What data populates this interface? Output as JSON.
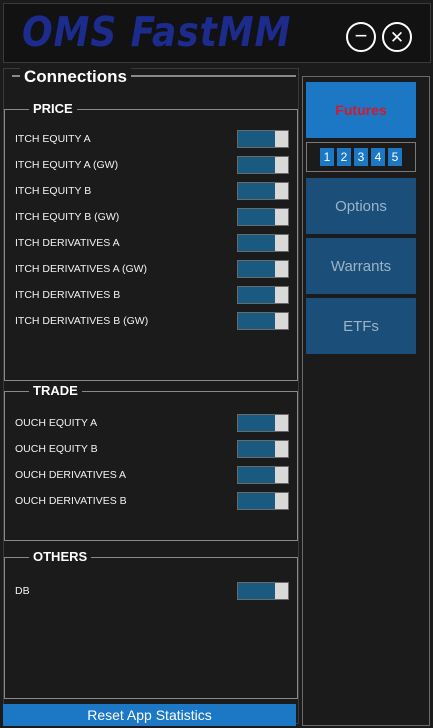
{
  "app": {
    "title": "OMS FastMM",
    "minimize_icon": "−",
    "close_icon": "✕"
  },
  "connections": {
    "title": "Connections",
    "groups": [
      {
        "title": "PRICE",
        "items": [
          {
            "label": "ITCH EQUITY A",
            "on": true
          },
          {
            "label": "ITCH EQUITY A (GW)",
            "on": true
          },
          {
            "label": "ITCH EQUITY B",
            "on": true
          },
          {
            "label": "ITCH EQUITY B (GW)",
            "on": true
          },
          {
            "label": "ITCH DERIVATIVES A",
            "on": true
          },
          {
            "label": "ITCH DERIVATIVES A (GW)",
            "on": true
          },
          {
            "label": "ITCH DERIVATIVES B",
            "on": true
          },
          {
            "label": "ITCH DERIVATIVES B (GW)",
            "on": true
          }
        ]
      },
      {
        "title": "TRADE",
        "items": [
          {
            "label": "OUCH EQUITY A",
            "on": true
          },
          {
            "label": "OUCH EQUITY B",
            "on": true
          },
          {
            "label": "OUCH DERIVATIVES A",
            "on": true
          },
          {
            "label": "OUCH DERIVATIVES B",
            "on": true
          }
        ]
      },
      {
        "title": "OTHERS",
        "items": [
          {
            "label": "DB",
            "on": true
          }
        ]
      }
    ],
    "reset_label": "Reset App Statistics"
  },
  "sidebar": {
    "active": "Futures",
    "numbers": [
      "1",
      "2",
      "3",
      "4",
      "5"
    ],
    "others": [
      "Options",
      "Warrants",
      "ETFs"
    ]
  },
  "colors": {
    "accent": "#1c78c5",
    "active_text": "#d3192a",
    "toggle_track": "#1a5a80",
    "title_text": "#1d2c8a"
  }
}
